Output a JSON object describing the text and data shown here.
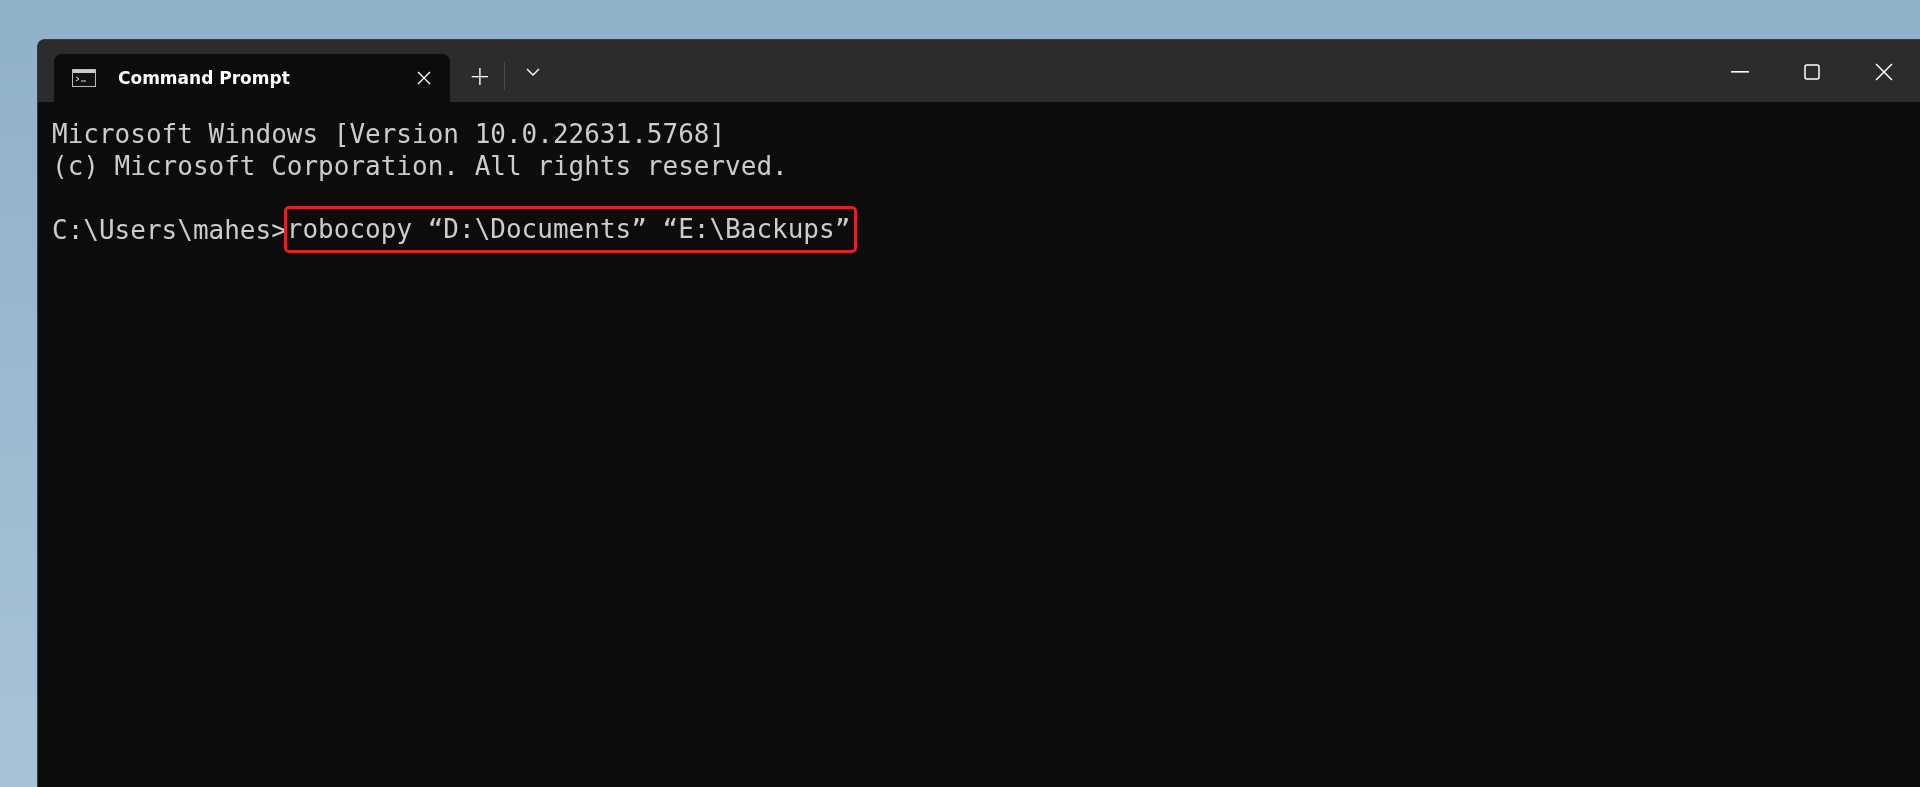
{
  "window": {
    "tabs": [
      {
        "title": "Command Prompt",
        "selected": true
      }
    ],
    "new_tab": "+"
  },
  "terminal": {
    "output": [
      "Microsoft Windows [Version 10.0.22631.5768]",
      "(c) Microsoft Corporation. All rights reserved."
    ],
    "prompt": {
      "path": "C:\\Users\\mahes>",
      "command": "robocopy “D:\\Documents” “E:\\Backups”",
      "highlighted": true
    }
  }
}
